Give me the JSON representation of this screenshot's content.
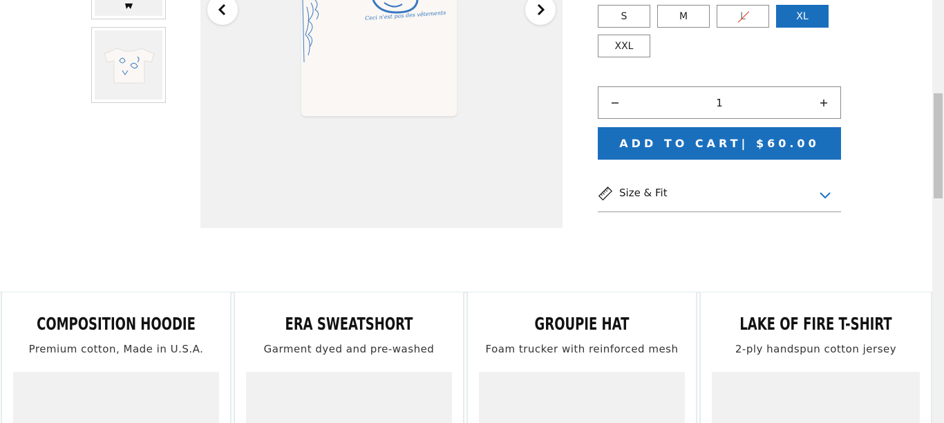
{
  "product": {
    "sizes": [
      {
        "label": "S",
        "state": "available"
      },
      {
        "label": "M",
        "state": "available"
      },
      {
        "label": "L",
        "state": "unavailable"
      },
      {
        "label": "XL",
        "state": "selected"
      },
      {
        "label": "XXL",
        "state": "available"
      }
    ],
    "quantity": "1",
    "add_to_cart": "ADD TO CART| $60.00",
    "size_fit_label": "Size & Fit",
    "shirt_script_text": "Ceci n'est pas des vêtements"
  },
  "icons": {
    "prev": "chevron-left-icon",
    "next": "chevron-right-icon",
    "ruler": "ruler-icon",
    "expand": "chevron-down-icon",
    "minus": "minus-icon",
    "plus": "plus-icon"
  },
  "colors": {
    "accent": "#1a6fbd",
    "image_bg": "#f1f1f1",
    "card_border": "#e4ecee",
    "unavailable_strike": "#e0301e"
  },
  "related": [
    {
      "title": "COMPOSITION HOODIE",
      "desc": "Premium cotton, Made in U.S.A."
    },
    {
      "title": "ERA SWEATSHORT",
      "desc": "Garment dyed and pre-washed"
    },
    {
      "title": "GROUPIE HAT",
      "desc": "Foam trucker with reinforced mesh"
    },
    {
      "title": "LAKE OF FIRE T-SHIRT",
      "desc": "2-ply handspun cotton jersey"
    }
  ]
}
